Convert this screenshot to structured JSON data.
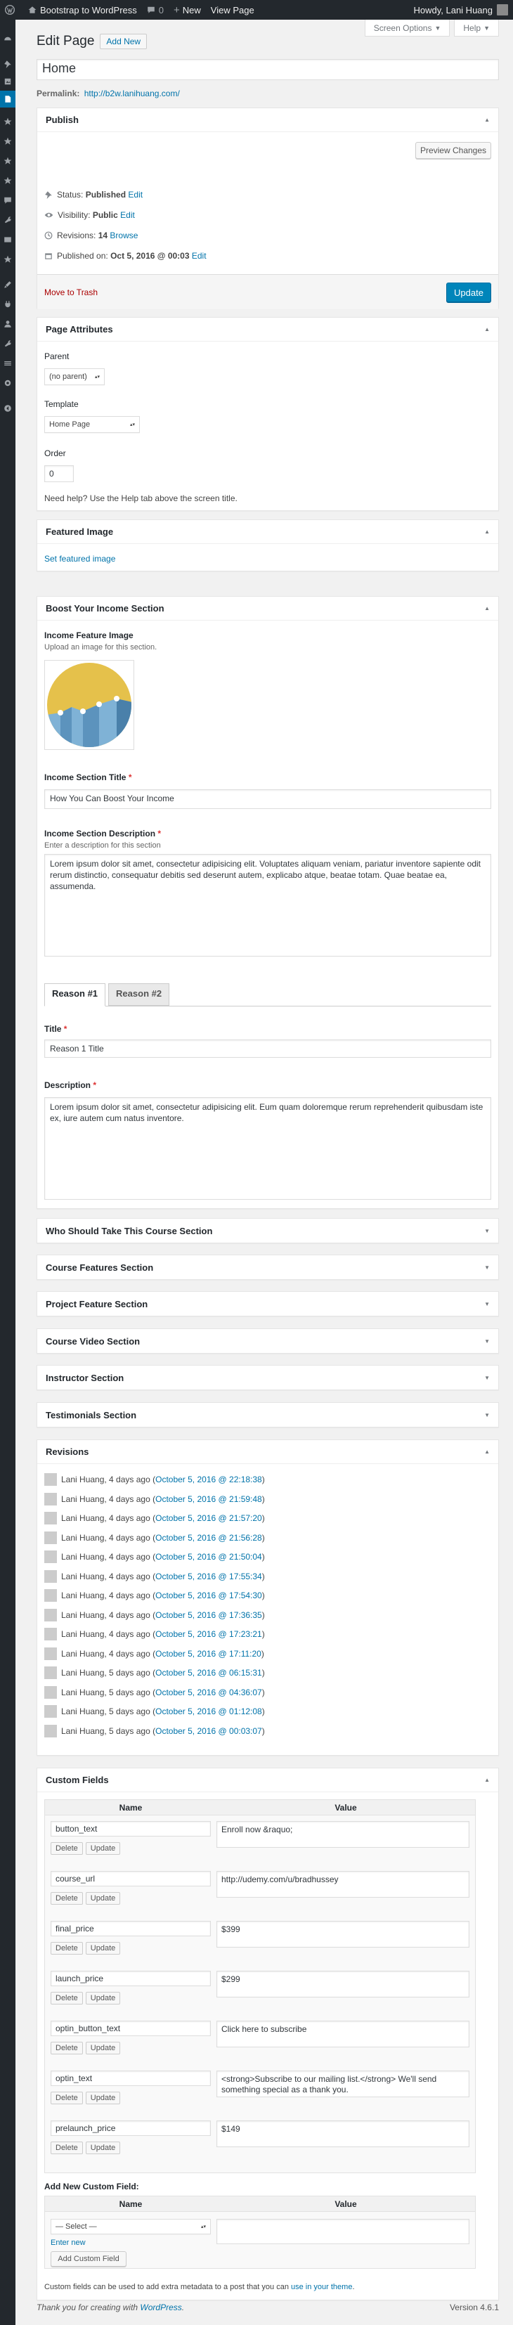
{
  "admin_bar": {
    "site_name": "Bootstrap to WordPress",
    "comments_count": "0",
    "new_label": "New",
    "view_page": "View Page",
    "howdy": "Howdy, Lani Huang"
  },
  "screen_options": "Screen Options",
  "help": "Help",
  "page_heading": "Edit Page",
  "add_new": "Add New",
  "post_title": "Home",
  "permalink": {
    "label": "Permalink:",
    "url": "http://b2w.lanihuang.com/"
  },
  "publish": {
    "title": "Publish",
    "preview_changes": "Preview Changes",
    "status_label": "Status:",
    "status_value": "Published",
    "status_edit": "Edit",
    "visibility_label": "Visibility:",
    "visibility_value": "Public",
    "visibility_edit": "Edit",
    "revisions_label": "Revisions:",
    "revisions_value": "14",
    "revisions_browse": "Browse",
    "published_label": "Published on:",
    "published_value": "Oct 5, 2016 @ 00:03",
    "published_edit": "Edit",
    "move_to_trash": "Move to Trash",
    "update": "Update"
  },
  "page_attributes": {
    "title": "Page Attributes",
    "parent_label": "Parent",
    "parent_value": "(no parent)",
    "template_label": "Template",
    "template_value": "Home Page",
    "order_label": "Order",
    "order_value": "0",
    "help_text": "Need help? Use the Help tab above the screen title."
  },
  "featured_image": {
    "title": "Featured Image",
    "set_link": "Set featured image"
  },
  "boost": {
    "title": "Boost Your Income Section",
    "image_label": "Income Feature Image",
    "image_desc": "Upload an image for this section.",
    "section_title_label": "Income Section Title",
    "section_title_value": "How You Can Boost Your Income",
    "section_desc_label": "Income Section Description",
    "section_desc_hint": "Enter a description for this section",
    "section_desc_value": "Lorem ipsum dolor sit amet, consectetur adipisicing elit. Voluptates aliquam veniam, pariatur inventore sapiente odit rerum distinctio, consequatur debitis sed deserunt autem, explicabo atque, beatae totam. Quae beatae ea, assumenda.",
    "tabs": [
      "Reason #1",
      "Reason #2"
    ],
    "reason_title_label": "Title",
    "reason_title_value": "Reason 1 Title",
    "reason_desc_label": "Description",
    "reason_desc_value": "Lorem ipsum dolor sit amet, consectetur adipisicing elit. Eum quam doloremque rerum reprehenderit quibusdam iste ex, iure autem cum natus inventore."
  },
  "collapsed_sections": [
    "Who Should Take This Course Section",
    "Course Features Section",
    "Project Feature Section",
    "Course Video Section",
    "Instructor Section",
    "Testimonials Section"
  ],
  "revisions": {
    "title": "Revisions",
    "items": [
      {
        "author": "Lani Huang, 4 days ago",
        "date": "October 5, 2016 @ 22:18:38"
      },
      {
        "author": "Lani Huang, 4 days ago",
        "date": "October 5, 2016 @ 21:59:48"
      },
      {
        "author": "Lani Huang, 4 days ago",
        "date": "October 5, 2016 @ 21:57:20"
      },
      {
        "author": "Lani Huang, 4 days ago",
        "date": "October 5, 2016 @ 21:56:28"
      },
      {
        "author": "Lani Huang, 4 days ago",
        "date": "October 5, 2016 @ 21:50:04"
      },
      {
        "author": "Lani Huang, 4 days ago",
        "date": "October 5, 2016 @ 17:55:34"
      },
      {
        "author": "Lani Huang, 4 days ago",
        "date": "October 5, 2016 @ 17:54:30"
      },
      {
        "author": "Lani Huang, 4 days ago",
        "date": "October 5, 2016 @ 17:36:35"
      },
      {
        "author": "Lani Huang, 4 days ago",
        "date": "October 5, 2016 @ 17:23:21"
      },
      {
        "author": "Lani Huang, 4 days ago",
        "date": "October 5, 2016 @ 17:11:20"
      },
      {
        "author": "Lani Huang, 5 days ago",
        "date": "October 5, 2016 @ 06:15:31"
      },
      {
        "author": "Lani Huang, 5 days ago",
        "date": "October 5, 2016 @ 04:36:07"
      },
      {
        "author": "Lani Huang, 5 days ago",
        "date": "October 5, 2016 @ 01:12:08"
      },
      {
        "author": "Lani Huang, 5 days ago",
        "date": "October 5, 2016 @ 00:03:07"
      }
    ]
  },
  "custom_fields": {
    "title": "Custom Fields",
    "col_name": "Name",
    "col_value": "Value",
    "delete": "Delete",
    "update": "Update",
    "rows": [
      {
        "name": "button_text",
        "value": "Enroll now &raquo;"
      },
      {
        "name": "course_url",
        "value": "http://udemy.com/u/bradhussey"
      },
      {
        "name": "final_price",
        "value": "$399"
      },
      {
        "name": "launch_price",
        "value": "$299"
      },
      {
        "name": "optin_button_text",
        "value": "Click here to subscribe"
      },
      {
        "name": "optin_text",
        "value": "<strong>Subscribe to our mailing list.</strong> We'll send something special as a thank you."
      },
      {
        "name": "prelaunch_price",
        "value": "$149"
      }
    ],
    "add_new_label": "Add New Custom Field:",
    "select_placeholder": "— Select —",
    "enter_new": "Enter new",
    "add_button": "Add Custom Field",
    "note_prefix": "Custom fields can be used to add extra metadata to a post that you can ",
    "note_link": "use in your theme",
    "note_suffix": "."
  },
  "footer": {
    "thanks_prefix": "Thank you for creating with ",
    "thanks_link": "WordPress",
    "thanks_suffix": ".",
    "version": "Version 4.6.1"
  },
  "colors": {
    "accent": "#0073aa",
    "admin_bar": "#23282d",
    "trash": "#a00",
    "primary_button": "#0085ba"
  }
}
